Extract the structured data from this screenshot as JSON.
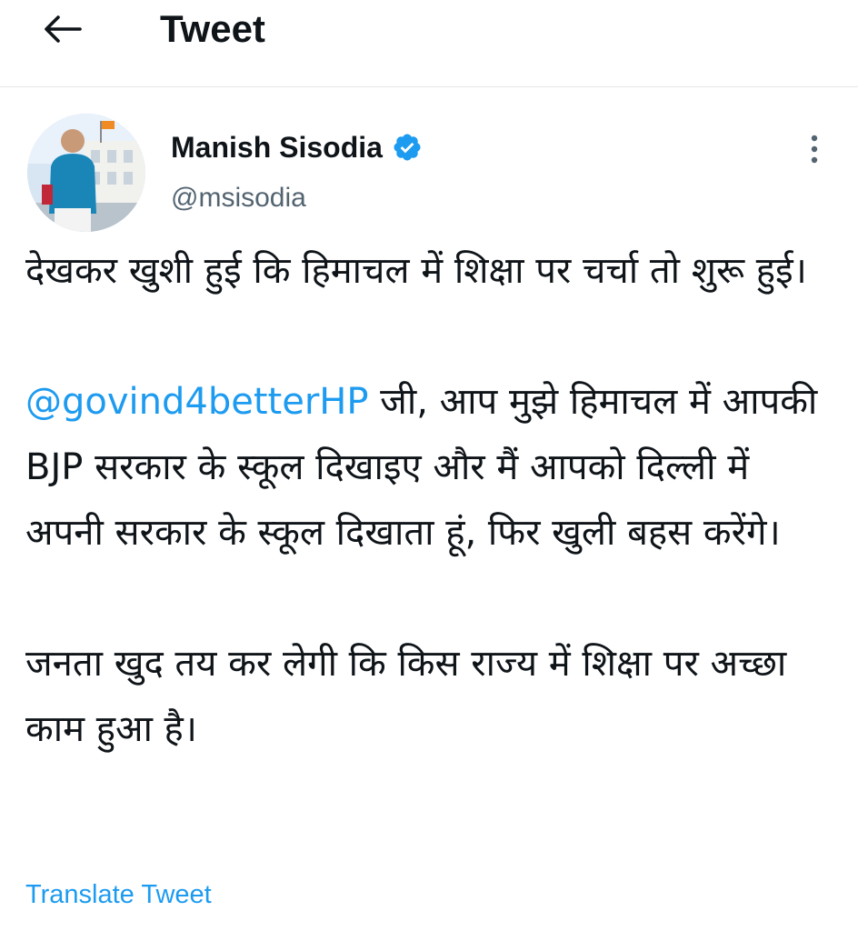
{
  "header": {
    "title": "Tweet",
    "back_icon": "arrow-left-icon"
  },
  "author": {
    "name": "Manish Sisodia",
    "handle": "@msisodia",
    "verified": true,
    "verified_icon": "verified-badge-icon",
    "avatar_icon": "profile-photo"
  },
  "more_icon": "more-vertical-icon",
  "tweet": {
    "paragraph1": "देखकर खुशी हुई कि हिमाचल में शिक्षा पर चर्चा तो शुरू हुई।",
    "mention": "@govind4betterHP",
    "paragraph2_rest": " जी, आप मुझे हिमाचल में आपकी BJP सरकार के स्कूल दिखाइए और मैं आपको दिल्ली में अपनी सरकार के स्कूल दिखाता हूं, फिर खुली बहस करेंगे।",
    "paragraph3": "जनता खुद तय कर लेगी कि किस राज्य में शिक्षा पर अच्छा काम हुआ है।"
  },
  "translate_label": "Translate Tweet",
  "colors": {
    "accent": "#1d9bf0",
    "text": "#0f1419",
    "secondary": "#536471"
  }
}
